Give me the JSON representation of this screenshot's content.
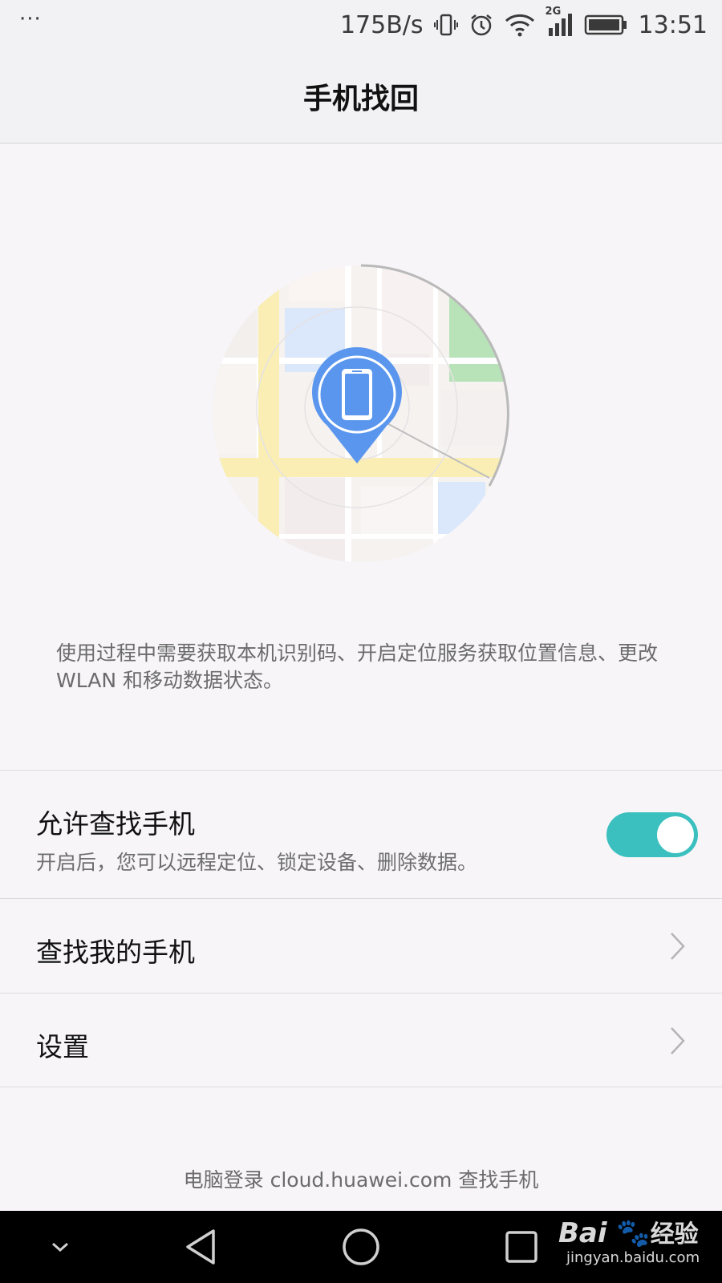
{
  "status_bar": {
    "overflow_dots": "···",
    "net_speed": "175B/s",
    "network_type": "2G",
    "time": "13:51",
    "icons": [
      "vibrate-icon",
      "alarm-icon",
      "wifi-icon",
      "signal-icon",
      "battery-icon"
    ]
  },
  "header": {
    "title": "手机找回"
  },
  "illustration": {
    "icons": [
      "map-illustration",
      "location-pin-icon",
      "phone-icon"
    ]
  },
  "notice": "使用过程中需要获取本机识别码、开启定位服务获取位置信息、更改 WLAN 和移动数据状态。",
  "settings": {
    "allow_find": {
      "title": "允许查找手机",
      "subtitle": "开启后，您可以远程定位、锁定设备、删除数据。",
      "enabled": true
    },
    "find_my_phone": {
      "title": "查找我的手机"
    },
    "settings_item": {
      "title": "设置"
    }
  },
  "footer": {
    "text": "电脑登录 cloud.huawei.com 查找手机"
  },
  "nav_bar": {
    "icons": [
      "collapse-icon",
      "back-icon",
      "home-icon",
      "recents-icon"
    ]
  },
  "watermark": {
    "brand": "Bai",
    "brand_suffix": "经验",
    "url": "jingyan.baidu.com"
  },
  "colors": {
    "accent": "#3bbfbf",
    "pin": "#5b96ee",
    "background": "#f7f5f8"
  }
}
